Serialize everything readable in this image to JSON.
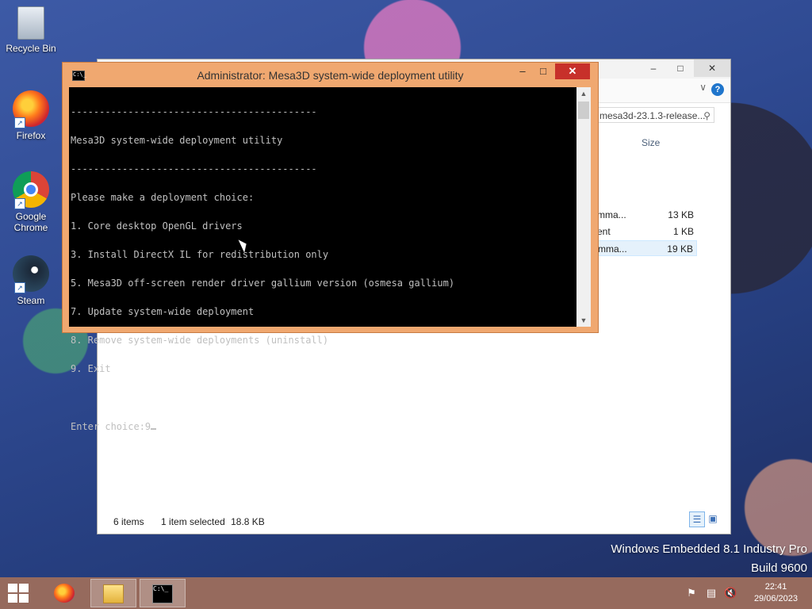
{
  "desktop": {
    "icons": [
      {
        "label": "Recycle Bin",
        "icon": "recycle-bin-icon"
      },
      {
        "label": "Firefox",
        "icon": "firefox-icon"
      },
      {
        "label": "Google Chrome",
        "icon": "chrome-icon"
      },
      {
        "label": "Steam",
        "icon": "steam-icon"
      }
    ],
    "watermark": {
      "line1": "Windows Embedded 8.1 Industry Pro",
      "line2": "Build 9600"
    }
  },
  "console": {
    "title": "Administrator:  Mesa3D system-wide deployment utility",
    "icon_text": "C:\\_",
    "buttons": {
      "minimize": "–",
      "maximize": "□",
      "close": "✕"
    },
    "lines": [
      "-------------------------------------------",
      "Mesa3D system-wide deployment utility",
      "-------------------------------------------",
      "Please make a deployment choice:",
      "1. Core desktop OpenGL drivers",
      "3. Install DirectX IL for redistribution only",
      "5. Mesa3D off-screen render driver gallium version (osmesa gallium)",
      "7. Update system-wide deployment",
      "8. Remove system-wide deployments (uninstall)",
      "9. Exit",
      "",
      "Enter choice:9"
    ],
    "scroll_up": "▲",
    "scroll_down": "▼"
  },
  "explorer": {
    "buttons": {
      "minimize": "–",
      "maximize": "□",
      "close": "✕"
    },
    "ribbon_chevron": "∨",
    "help": "?",
    "search_text": "mesa3d-23.1.3-release...",
    "column_size": "Size",
    "rows": [
      {
        "name": "mma...",
        "size": "13 KB",
        "selected": false
      },
      {
        "name": "ent",
        "size": "1 KB",
        "selected": false
      },
      {
        "name": "mma...",
        "size": "19 KB",
        "selected": true
      }
    ],
    "status": {
      "items": "6 items",
      "selected": "1 item selected",
      "size": "18.8 KB"
    }
  },
  "taskbar": {
    "apps": [
      "firefox",
      "file-explorer",
      "command-prompt"
    ],
    "clock": {
      "time": "22:41",
      "date": "29/06/2023"
    }
  }
}
